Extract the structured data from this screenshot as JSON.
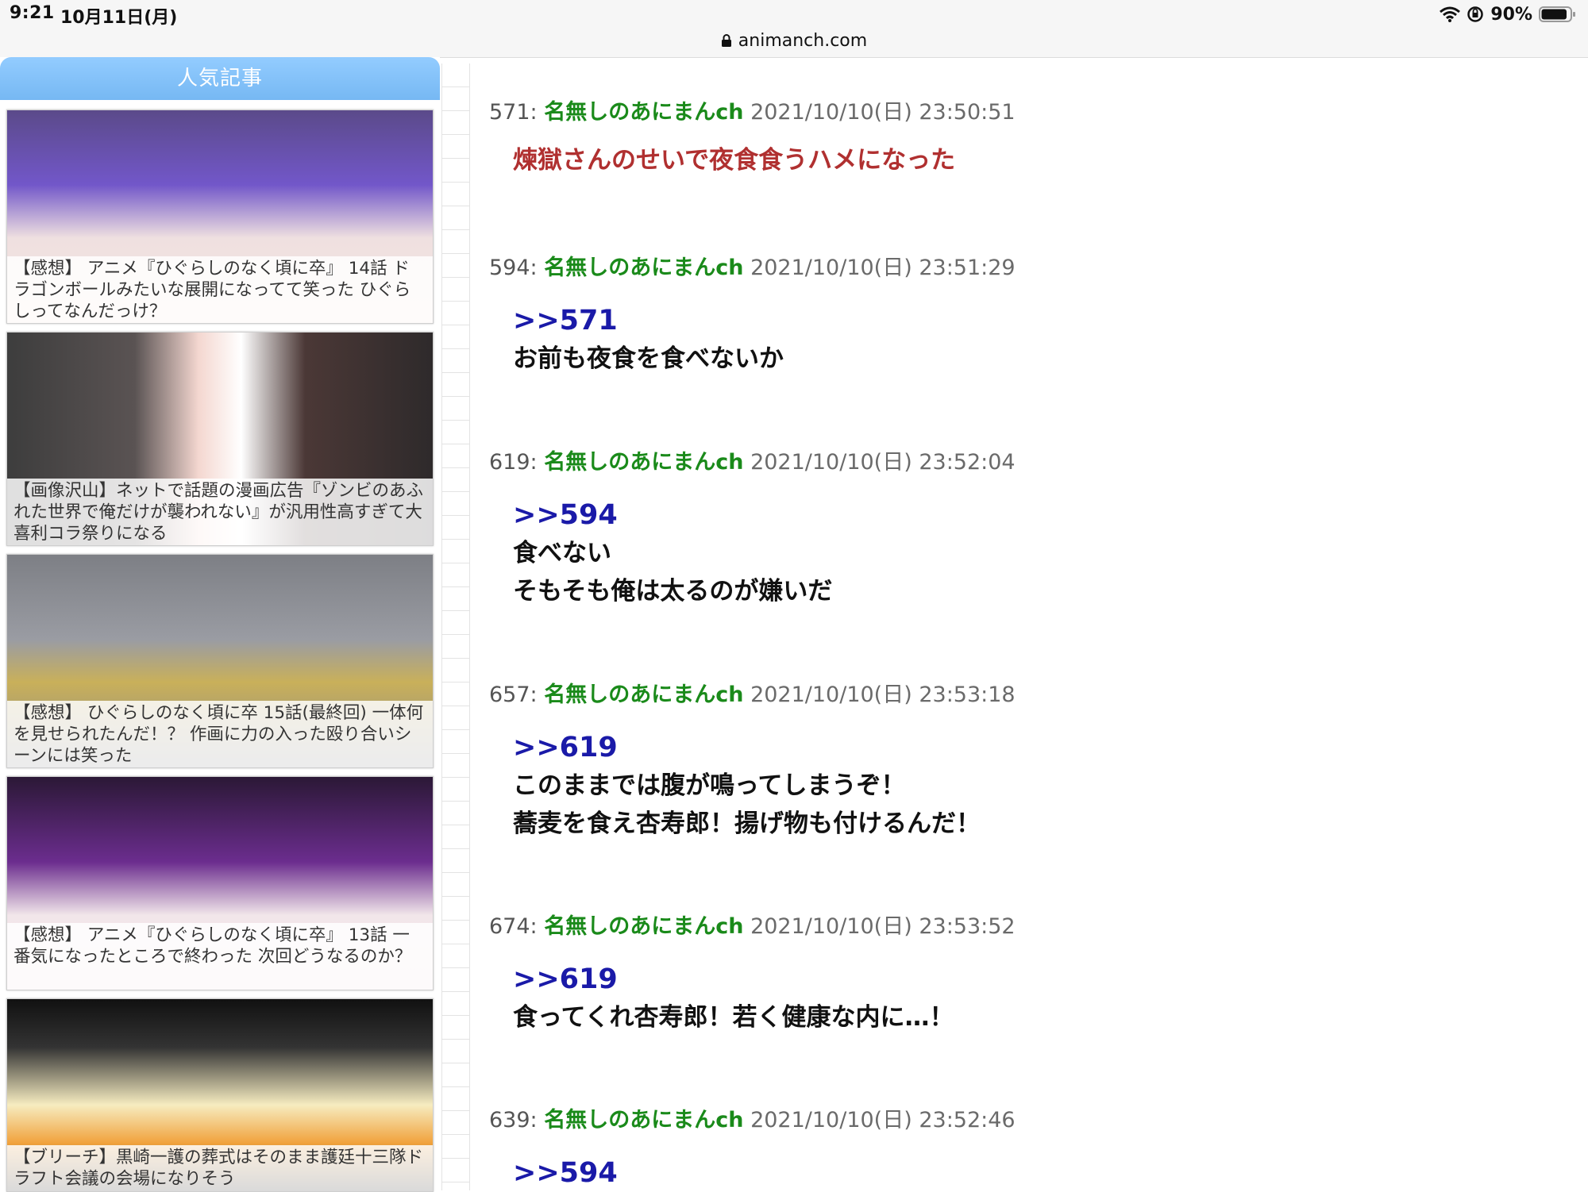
{
  "status_bar": {
    "time": "9:21",
    "date": "10月11日(月)",
    "battery_percent": "90%",
    "battery_level": 0.9,
    "url": "animanch.com"
  },
  "sidebar": {
    "title": "人気記事",
    "articles": [
      {
        "caption": "【感想】 アニメ『ひぐらしのなく頃に卒』 14話 ドラゴンボールみたいな展開になってて笑った ひぐらしってなんだっけ？"
      },
      {
        "caption": "【画像沢山】ネットで話題の漫画広告『ゾンビのあふれた世界で俺だけが襲われない』が汎用性高すぎて大喜利コラ祭りになる"
      },
      {
        "caption": "【感想】 ひぐらしのなく頃に卒 15話(最終回) 一体何を見せられたんだ！？ 作画に力の入った殴り合いシーンには笑った"
      },
      {
        "caption": "【感想】 アニメ『ひぐらしのなく頃に卒』 13話 一番気になったところで終わった 次回どうなるのか？"
      },
      {
        "caption": "【ブリーチ】黒崎一護の葬式はそのまま護廷十三隊ドラフト会議の会場になりそう"
      }
    ]
  },
  "thread": {
    "posts": [
      {
        "num": "571:",
        "name": "名無しのあにまんch",
        "date": "2021/10/10(日) 23:50:51",
        "anchor": "",
        "lines": [
          "煉獄さんのせいで夜食食うハメになった"
        ],
        "highlight": true
      },
      {
        "num": "594:",
        "name": "名無しのあにまんch",
        "date": "2021/10/10(日) 23:51:29",
        "anchor": ">>571",
        "lines": [
          "お前も夜食を食べないか"
        ]
      },
      {
        "num": "619:",
        "name": "名無しのあにまんch",
        "date": "2021/10/10(日) 23:52:04",
        "anchor": ">>594",
        "lines": [
          "食べない",
          "そもそも俺は太るのが嫌いだ"
        ]
      },
      {
        "num": "657:",
        "name": "名無しのあにまんch",
        "date": "2021/10/10(日) 23:53:18",
        "anchor": ">>619",
        "lines": [
          "このままでは腹が鳴ってしまうぞ！",
          "蕎麦を食え杏寿郎！揚げ物も付けるんだ！"
        ]
      },
      {
        "num": "674:",
        "name": "名無しのあにまんch",
        "date": "2021/10/10(日) 23:53:52",
        "anchor": ">>619",
        "lines": [
          "食ってくれ杏寿郎！若く健康な内に…！"
        ]
      },
      {
        "num": "639:",
        "name": "名無しのあにまんch",
        "date": "2021/10/10(日) 23:52:46",
        "anchor": ">>594",
        "lines": []
      }
    ]
  },
  "colors": {
    "sidebar_header": "#86c2fa",
    "poster_name": "#1a8a1a",
    "anchor_link": "#1a1aa8",
    "highlight_text": "#b03030"
  }
}
